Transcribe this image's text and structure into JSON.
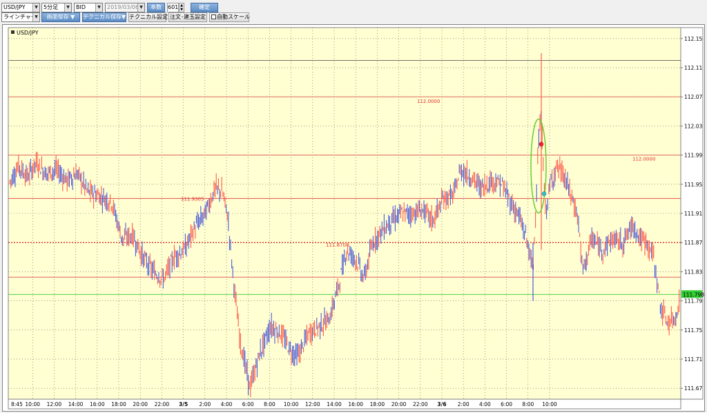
{
  "toolbar_row1": {
    "symbol": "USD/JPY",
    "timeframe": "5分足",
    "price_type": "BID",
    "date": "2019/03/06",
    "count_button": "本数",
    "count_value": "601",
    "confirm_button": "確定"
  },
  "toolbar_row2": {
    "chart_type": "ラインチャート",
    "screen_save": "画面保存 ▼",
    "technical_save": "テクニカル保存▼",
    "technical_settings": "テクニカル設定",
    "order_settings": "注文･建玉設定",
    "auto_scale": "自動スケール"
  },
  "chart_data": {
    "type": "candlestick",
    "symbol_label": "USD/JPY",
    "y_ticks": [
      "112.15",
      "112.11",
      "112.07",
      "112.03",
      "111.99",
      "111.95",
      "111.91",
      "111.87",
      "111.83",
      "111.79",
      "111.75",
      "111.71",
      "111.67"
    ],
    "y_values": [
      112.15,
      112.11,
      112.07,
      112.03,
      111.99,
      111.95,
      111.91,
      111.87,
      111.83,
      111.79,
      111.75,
      111.71,
      111.67
    ],
    "x_ticks": [
      "8:45",
      "10:00",
      "12:00",
      "14:00",
      "16:00",
      "18:00",
      "20:00",
      "22:00",
      "3/5",
      "2:00",
      "4:00",
      "6:00",
      "8:00",
      "10:00",
      "12:00",
      "14:00",
      "16:00",
      "18:00",
      "20:00",
      "22:00",
      "3/6",
      "2:00",
      "4:00",
      "6:00",
      "8:00",
      "10:00"
    ],
    "current_price": "111.7988",
    "current_price_value": 111.7988,
    "price_labels": [
      {
        "text": "112.0000",
        "value": 112.07
      },
      {
        "text": "112.0000",
        "value": 111.99
      },
      {
        "text": "111.9305",
        "value": 111.9305
      },
      {
        "text": "111.8700",
        "value": 111.87
      }
    ],
    "horizontal_lines": [
      {
        "value": 112.12,
        "color": "#606060",
        "style": "solid"
      },
      {
        "value": 112.07,
        "color": "#e05050",
        "style": "solid"
      },
      {
        "value": 111.99,
        "color": "#e05050",
        "style": "solid"
      },
      {
        "value": 111.9305,
        "color": "#e05050",
        "style": "solid"
      },
      {
        "value": 111.87,
        "color": "#cc0000",
        "style": "dashed"
      },
      {
        "value": 111.8225,
        "color": "#e05050",
        "style": "solid"
      },
      {
        "value": 111.7988,
        "color": "#33cc33",
        "style": "solid"
      }
    ],
    "grid": true,
    "colors": {
      "background": "#ffffd2",
      "up": "#ff5a4a",
      "down": "#4a5ad8",
      "current": "#33cc33",
      "ellipse": "#66cc33"
    }
  }
}
